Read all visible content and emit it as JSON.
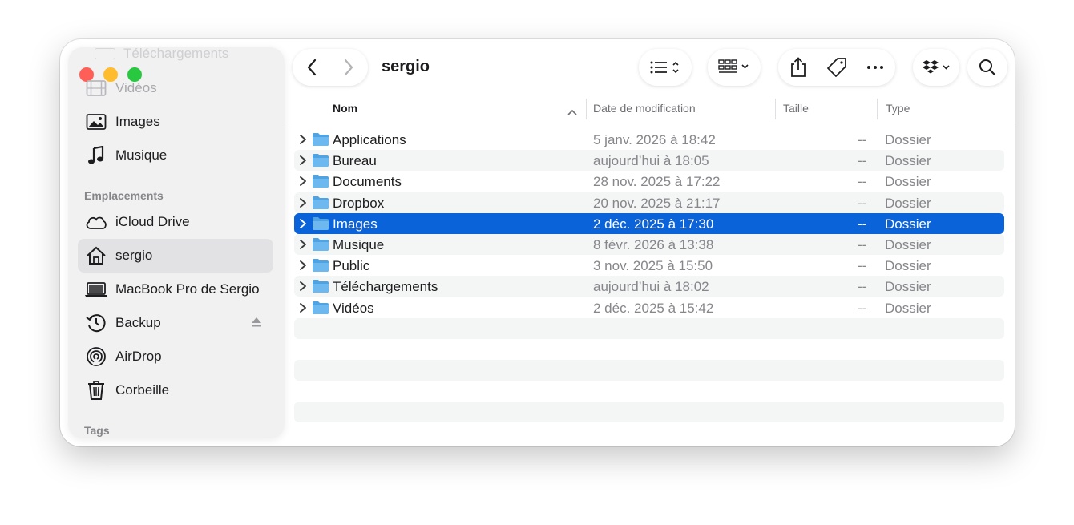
{
  "sidebar": {
    "ghost_label": "Téléchargements",
    "favorites": [
      {
        "label": "Vidéos",
        "icon": "film-icon"
      },
      {
        "label": "Images",
        "icon": "photo-icon"
      },
      {
        "label": "Musique",
        "icon": "music-note-icon"
      }
    ],
    "locations_title": "Emplacements",
    "locations": [
      {
        "label": "iCloud Drive",
        "icon": "cloud-icon"
      },
      {
        "label": "sergio",
        "icon": "home-icon",
        "active": true
      },
      {
        "label": "MacBook Pro de Sergio",
        "icon": "laptop-icon"
      },
      {
        "label": "Backup",
        "icon": "time-machine-icon"
      },
      {
        "label": "AirDrop",
        "icon": "airdrop-icon"
      },
      {
        "label": "Corbeille",
        "icon": "trash-icon"
      }
    ],
    "tags_title": "Tags"
  },
  "toolbar": {
    "title": "sergio",
    "back_icon": "chevron-left-icon",
    "forward_icon": "chevron-right-icon",
    "view_icon": "list-view-icon",
    "group_icon": "group-grid-icon",
    "share_icon": "share-icon",
    "tag_icon": "tag-icon",
    "more_icon": "ellipsis-icon",
    "dropbox_icon": "dropbox-icon",
    "search_icon": "search-icon"
  },
  "columns": {
    "name": "Nom",
    "date": "Date de modification",
    "size": "Taille",
    "type": "Type"
  },
  "files": [
    {
      "name": "Applications",
      "date": "5 janv. 2026 à 18:42",
      "size": "--",
      "type": "Dossier"
    },
    {
      "name": "Bureau",
      "date": "aujourd’hui à 18:05",
      "size": "--",
      "type": "Dossier"
    },
    {
      "name": "Documents",
      "date": "28 nov. 2025 à 17:22",
      "size": "--",
      "type": "Dossier"
    },
    {
      "name": "Dropbox",
      "date": "20 nov. 2025 à 21:17",
      "size": "--",
      "type": "Dossier"
    },
    {
      "name": "Images",
      "date": "2 déc. 2025 à 17:30",
      "size": "--",
      "type": "Dossier",
      "selected": true
    },
    {
      "name": "Musique",
      "date": "8 févr. 2026 à 13:38",
      "size": "--",
      "type": "Dossier"
    },
    {
      "name": "Public",
      "date": "3 nov. 2025 à 15:50",
      "size": "--",
      "type": "Dossier"
    },
    {
      "name": "Téléchargements",
      "date": "aujourd’hui à 18:02",
      "size": "--",
      "type": "Dossier"
    },
    {
      "name": "Vidéos",
      "date": "2 déc. 2025 à 15:42",
      "size": "--",
      "type": "Dossier"
    }
  ],
  "colors": {
    "selection": "#0a63d8",
    "folder": "#5aaee9",
    "close": "#ff5f57",
    "minimize": "#febc2e",
    "zoom": "#28c840"
  }
}
